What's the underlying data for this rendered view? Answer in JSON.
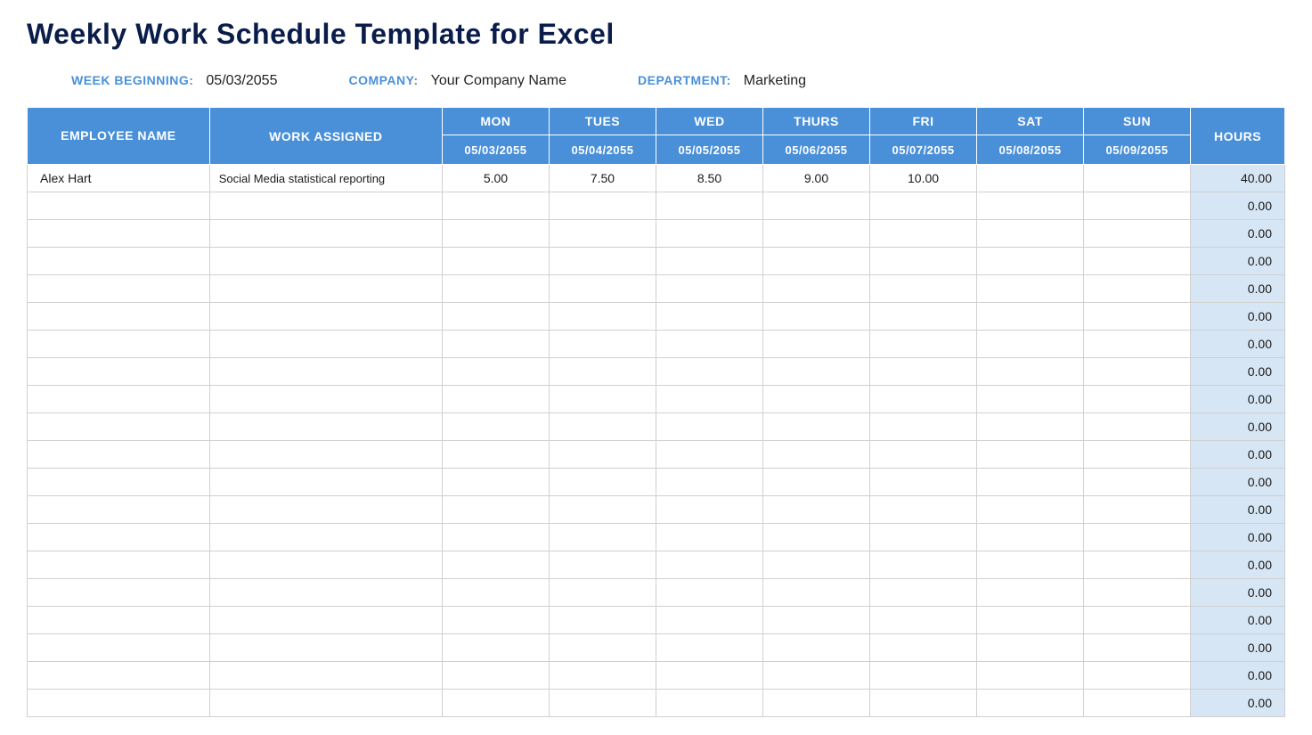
{
  "title": "Weekly Work Schedule Template for Excel",
  "meta": {
    "week_label": "WEEK BEGINNING:",
    "week_value": "05/03/2055",
    "company_label": "COMPANY:",
    "company_value": "Your Company Name",
    "department_label": "DEPARTMENT:",
    "department_value": "Marketing"
  },
  "headers": {
    "employee": "EMPLOYEE NAME",
    "work": "WORK ASSIGNED",
    "hours": "HOURS",
    "days": [
      "MON",
      "TUES",
      "WED",
      "THURS",
      "FRI",
      "SAT",
      "SUN"
    ],
    "dates": [
      "05/03/2055",
      "05/04/2055",
      "05/05/2055",
      "05/06/2055",
      "05/07/2055",
      "05/08/2055",
      "05/09/2055"
    ]
  },
  "rows": [
    {
      "name": "Alex Hart",
      "work": "Social Media statistical reporting",
      "days": [
        "5.00",
        "7.50",
        "8.50",
        "9.00",
        "10.00",
        "",
        ""
      ],
      "hours": "40.00"
    },
    {
      "name": "",
      "work": "",
      "days": [
        "",
        "",
        "",
        "",
        "",
        "",
        ""
      ],
      "hours": "0.00"
    },
    {
      "name": "",
      "work": "",
      "days": [
        "",
        "",
        "",
        "",
        "",
        "",
        ""
      ],
      "hours": "0.00"
    },
    {
      "name": "",
      "work": "",
      "days": [
        "",
        "",
        "",
        "",
        "",
        "",
        ""
      ],
      "hours": "0.00"
    },
    {
      "name": "",
      "work": "",
      "days": [
        "",
        "",
        "",
        "",
        "",
        "",
        ""
      ],
      "hours": "0.00"
    },
    {
      "name": "",
      "work": "",
      "days": [
        "",
        "",
        "",
        "",
        "",
        "",
        ""
      ],
      "hours": "0.00"
    },
    {
      "name": "",
      "work": "",
      "days": [
        "",
        "",
        "",
        "",
        "",
        "",
        ""
      ],
      "hours": "0.00"
    },
    {
      "name": "",
      "work": "",
      "days": [
        "",
        "",
        "",
        "",
        "",
        "",
        ""
      ],
      "hours": "0.00"
    },
    {
      "name": "",
      "work": "",
      "days": [
        "",
        "",
        "",
        "",
        "",
        "",
        ""
      ],
      "hours": "0.00"
    },
    {
      "name": "",
      "work": "",
      "days": [
        "",
        "",
        "",
        "",
        "",
        "",
        ""
      ],
      "hours": "0.00"
    },
    {
      "name": "",
      "work": "",
      "days": [
        "",
        "",
        "",
        "",
        "",
        "",
        ""
      ],
      "hours": "0.00"
    },
    {
      "name": "",
      "work": "",
      "days": [
        "",
        "",
        "",
        "",
        "",
        "",
        ""
      ],
      "hours": "0.00"
    },
    {
      "name": "",
      "work": "",
      "days": [
        "",
        "",
        "",
        "",
        "",
        "",
        ""
      ],
      "hours": "0.00"
    },
    {
      "name": "",
      "work": "",
      "days": [
        "",
        "",
        "",
        "",
        "",
        "",
        ""
      ],
      "hours": "0.00"
    },
    {
      "name": "",
      "work": "",
      "days": [
        "",
        "",
        "",
        "",
        "",
        "",
        ""
      ],
      "hours": "0.00"
    },
    {
      "name": "",
      "work": "",
      "days": [
        "",
        "",
        "",
        "",
        "",
        "",
        ""
      ],
      "hours": "0.00"
    },
    {
      "name": "",
      "work": "",
      "days": [
        "",
        "",
        "",
        "",
        "",
        "",
        ""
      ],
      "hours": "0.00"
    },
    {
      "name": "",
      "work": "",
      "days": [
        "",
        "",
        "",
        "",
        "",
        "",
        ""
      ],
      "hours": "0.00"
    },
    {
      "name": "",
      "work": "",
      "days": [
        "",
        "",
        "",
        "",
        "",
        "",
        ""
      ],
      "hours": "0.00"
    },
    {
      "name": "",
      "work": "",
      "days": [
        "",
        "",
        "",
        "",
        "",
        "",
        ""
      ],
      "hours": "0.00"
    }
  ]
}
